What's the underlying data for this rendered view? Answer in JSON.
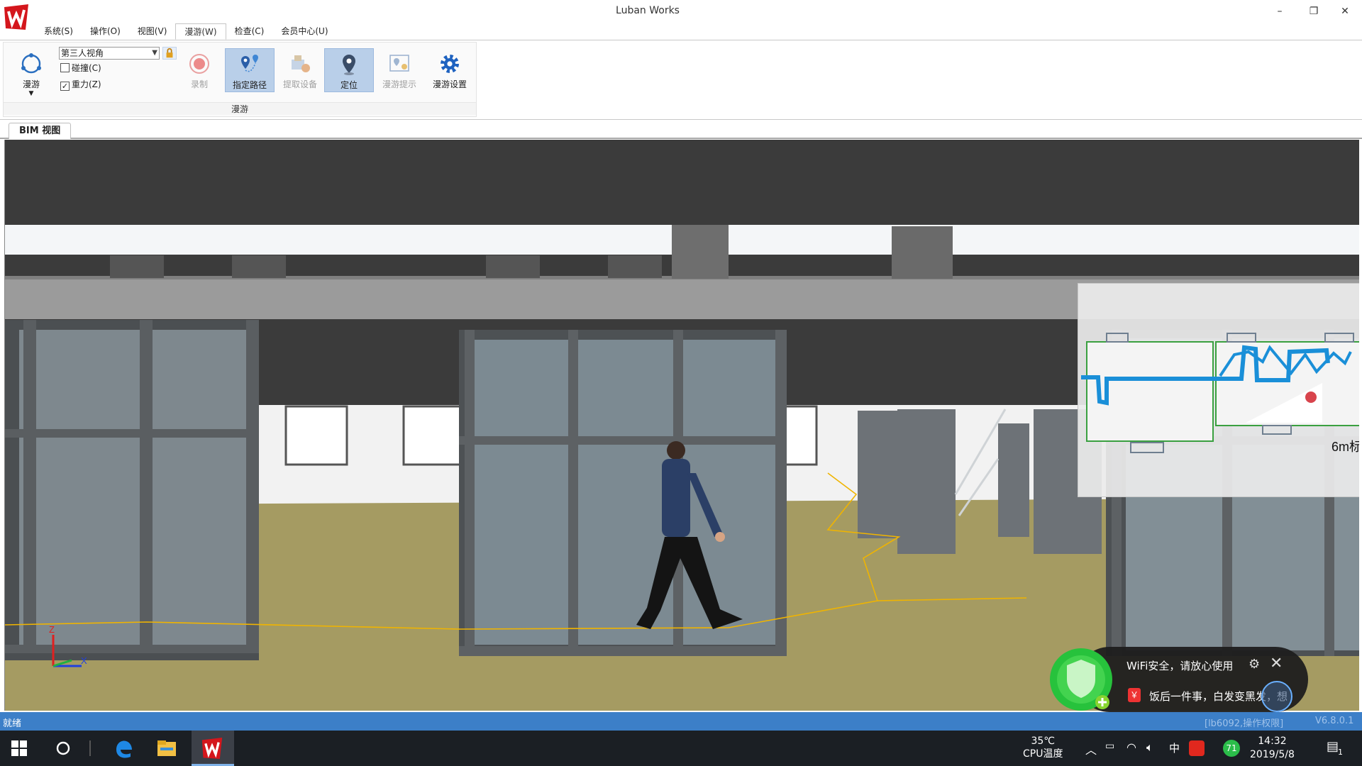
{
  "window": {
    "title": "Luban Works",
    "minimize": "–",
    "restore": "❐",
    "close": "✕"
  },
  "menu": [
    {
      "label": "系统(S)"
    },
    {
      "label": "操作(O)"
    },
    {
      "label": "视图(V)"
    },
    {
      "label": "漫游(W)",
      "active": true
    },
    {
      "label": "检查(C)"
    },
    {
      "label": "会员中心(U)"
    }
  ],
  "ribbon": {
    "roam_label": "漫游",
    "view_mode_select": "第三人视角",
    "collision_label": "碰撞(C)",
    "collision_checked": false,
    "gravity_label": "重力(Z)",
    "gravity_checked": true,
    "record_label": "录制",
    "path_label": "指定路径",
    "extract_label": "提取设备",
    "locate_label": "定位",
    "hint_label": "漫游提示",
    "settings_label": "漫游设置",
    "group_caption": "漫游"
  },
  "doc_tab": {
    "label": "BIM 视图"
  },
  "viewport": {
    "minimap_scale": "6m标",
    "axis_z": "Z",
    "axis_x": "X"
  },
  "toast": {
    "line1": "WiFi安全，请放心使用",
    "line2": "饭后一件事，白发变黑发，想",
    "red_badge": "￥",
    "settings_icon": "gear-icon",
    "close_icon": "close-icon"
  },
  "status": {
    "text": "就绪",
    "permission": "[lb6092,操作权限]",
    "version": "V6.8.0.1"
  },
  "taskbar": {
    "cpu_temp": "35℃",
    "cpu_label": "CPU温度",
    "ime": "中",
    "badge": "71",
    "time": "14:32",
    "date": "2019/5/8",
    "notification_count": "1"
  },
  "colors": {
    "accent": "#3c7fc8",
    "ribbon_pressed": "#b9cfe9",
    "floor": "#a59b62",
    "path_line": "#f0b400",
    "minimap_route": "#1a8fd8"
  }
}
